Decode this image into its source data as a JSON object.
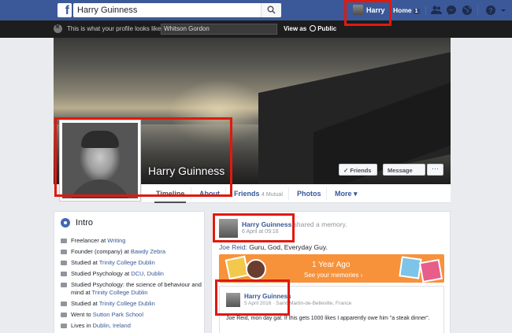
{
  "topbar": {
    "search_value": "Harry Guinness",
    "user_name": "Harry",
    "home_label": "Home",
    "home_badge": "1",
    "icons": [
      "friends-icon",
      "messenger-icon",
      "globe-icon",
      "help-icon"
    ]
  },
  "viewbar": {
    "text": "This is what your profile looks like to:",
    "viewer_value": "Whitson Gordon",
    "view_as_label": "View as",
    "view_as_value": "Public"
  },
  "profile": {
    "name": "Harry Guinness",
    "friends_button": "✓ Friends",
    "message_button": "Message",
    "more_button": "···"
  },
  "nav": {
    "tabs": [
      {
        "label": "Timeline"
      },
      {
        "label": "About"
      },
      {
        "label": "Friends",
        "extra": "4 Mutual"
      },
      {
        "label": "Photos"
      },
      {
        "label": "More ▾"
      }
    ]
  },
  "intro": {
    "title": "Intro",
    "items": [
      {
        "prefix": "Freelancer at ",
        "link": "Writing",
        "suffix": ""
      },
      {
        "prefix": "Founder (company) at ",
        "link": "Bawdy Zebra",
        "suffix": ""
      },
      {
        "prefix": "Studied at ",
        "link": "Trinity College Dublin",
        "suffix": ""
      },
      {
        "prefix": "Studied Psychology at ",
        "link": "DCU, Dublin",
        "suffix": ""
      },
      {
        "prefix": "Studied Psychology: the science of behaviour and mind at ",
        "link": "Trinity College Dublin",
        "suffix": ""
      },
      {
        "prefix": "Studied at ",
        "link": "Trinity College Dublin",
        "suffix": ""
      },
      {
        "prefix": "Went to ",
        "link": "Sutton Park School",
        "suffix": ""
      },
      {
        "prefix": "Lives in ",
        "link": "Dublin, Ireland",
        "suffix": ""
      }
    ]
  },
  "feed": {
    "author": "Harry Guinness",
    "action": " shared a memory.",
    "time": "6 April at 09:16",
    "quote_link": "Joe Reid",
    "quote_text": ": Guru, God, Everyday Guy.",
    "memory_title": "1 Year Ago",
    "memory_sub": "See your memories ›",
    "shared_name": "Harry Guinness",
    "shared_meta": "5 April 2016 · Saint-Martin-de-Belleville, France",
    "shared_text": "Joe Reid, mon day gat. If this gets 1000 likes I apparently owe him \"a steak dinner\"."
  },
  "colors": {
    "brand_blue": "#3b5998",
    "highlight_red": "#e0190e",
    "memory_orange": "#f7923a",
    "link_blue": "#365899"
  }
}
